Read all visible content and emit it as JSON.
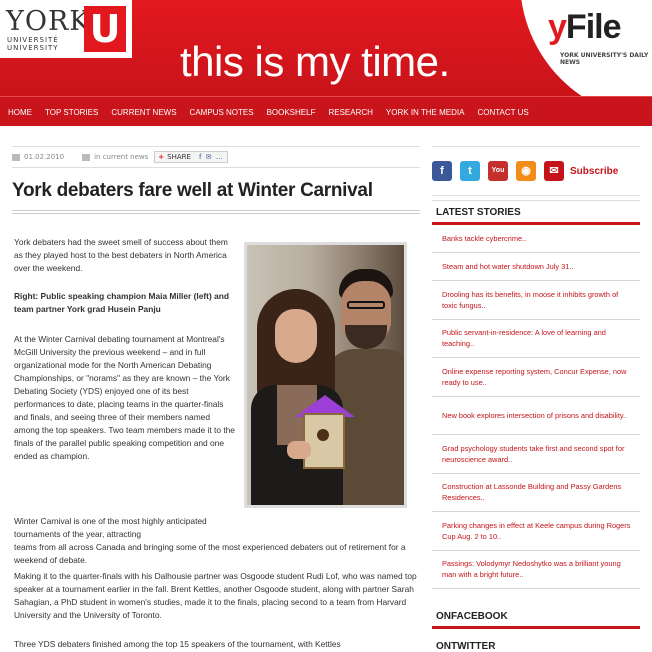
{
  "header": {
    "logo_word": "YORK",
    "logo_univ": "UNIVERSITÉ UNIVERSITY",
    "logo_u": "U",
    "tagline": "this is my time.",
    "yfile_y": "y",
    "yfile_rest": "File",
    "yfile_sub": "YORK UNIVERSITY'S DAILY NEWS"
  },
  "nav": {
    "items": [
      "HOME",
      "TOP STORIES",
      "CURRENT NEWS",
      "CAMPUS NOTES",
      "BOOKSHELF",
      "RESEARCH",
      "YORK IN THE MEDIA",
      "CONTACT US"
    ]
  },
  "article": {
    "date": "01.02.2010",
    "category": "in current news",
    "share_label": "SHARE",
    "share_icons": "f ✉ …",
    "title": "York debaters fare well at Winter Carnival",
    "p1": "York debaters had the sweet smell of success about them as they played host to the best debaters in North America over the weekend.",
    "p2": "Right: Public speaking champion Maia Miller (left) and team partner York grad Husein Panju",
    "p3": "At the Winter Carnival debating tournament at Montreal's McGill University the previous weekend – and in full organizational mode for the North American Debating Championships, or \"norams\" as they are known – the York Debating Society (YDS) enjoyed one of its best performances to date, placing teams in the quarter-finals and finals, and seeing three of their members named among the top speakers. Two team members made it to the finals of the parallel public speaking competition and one ended as champion.",
    "p4a": "Winter Carnival is one of the most highly anticipated tournaments of the year, attracting",
    "p4b": "teams from all across Canada and bringing some of the most experienced debaters out of retirement for a weekend of debate.",
    "p5": "Making it to the quarter-finals with his Dalhousie partner was Osgoode student Rudi Lof, who was named top speaker at a tournament earlier in the fall. Brent Kettles, another Osgoode student, along with partner Sarah Sahagian, a PhD student in women's studies, made it to the finals, placing second to a team from Harvard University and the University of Toronto.",
    "p6": "Three YDS debaters finished among the top 15 speakers of the tournament, with Kettles"
  },
  "sidebar": {
    "social": {
      "facebook": "f",
      "twitter": "t",
      "youtube": "You Tube",
      "rss": "◉",
      "subscribe_icon": "✉",
      "subscribe": "Subscribe"
    },
    "latest_heading": "LATEST STORIES",
    "stories": [
      "Banks tackle cybercrime..",
      "Steam and hot water shutdown July 31..",
      "Drooling has its benefits, in moose it inhibits growth of toxic fungus..",
      "Public servant-in-residence: A love of learning and teaching..",
      "Online expense reporting system, Concur Expense, now ready to use..",
      "New book explores intersection of prisons and disability..",
      "Grad psychology students take first and second spot for neuroscience award..",
      "Construction at Lassonde Building and Passy Gardens Residences..",
      "Parking changes in effect at Keele campus during Rogers Cup Aug. 2 to 10..",
      "Passings: Volodymyr Nedoshytko was a brilliant young man with a bright future.."
    ],
    "facebook_heading": "ONFACEBOOK",
    "twitter_heading": "ONTWITTER"
  }
}
